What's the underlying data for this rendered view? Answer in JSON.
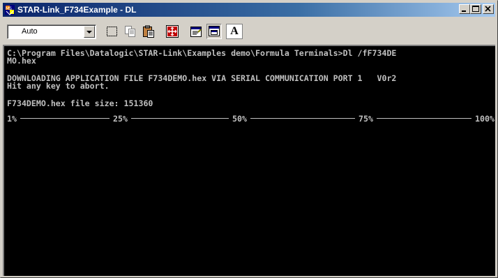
{
  "window": {
    "title": "STAR-Link_F734Example - DL",
    "controls": {
      "minimize": "_",
      "maximize": "□",
      "close": "×"
    }
  },
  "toolbar": {
    "font_size_select": {
      "value": "Auto"
    },
    "font_button_label": "A",
    "icons": [
      "mark-icon",
      "copy-icon",
      "paste-icon",
      "fullscreen-icon",
      "properties-icon",
      "background-icon"
    ]
  },
  "console": {
    "lines": [
      "C:\\Program Files\\Datalogic\\STAR-Link\\Examples demo\\Formula Terminals>Dl /fF734DE",
      "MO.hex",
      "DOWNLOADING APPLICATION FILE F734DEMO.hex VIA SERIAL COMMUNICATION PORT 1   V0r2",
      "Hit any key to abort.",
      "F734DEMO.hex file size: 151360"
    ],
    "progress_scale": [
      "1%",
      "25%",
      "50%",
      "75%",
      "100%"
    ]
  },
  "colors": {
    "titlebar_start": "#0a246a",
    "titlebar_end": "#a6caf0",
    "console_bg": "#000000",
    "console_text": "#c0c0c0",
    "chrome": "#d4d0c8"
  }
}
